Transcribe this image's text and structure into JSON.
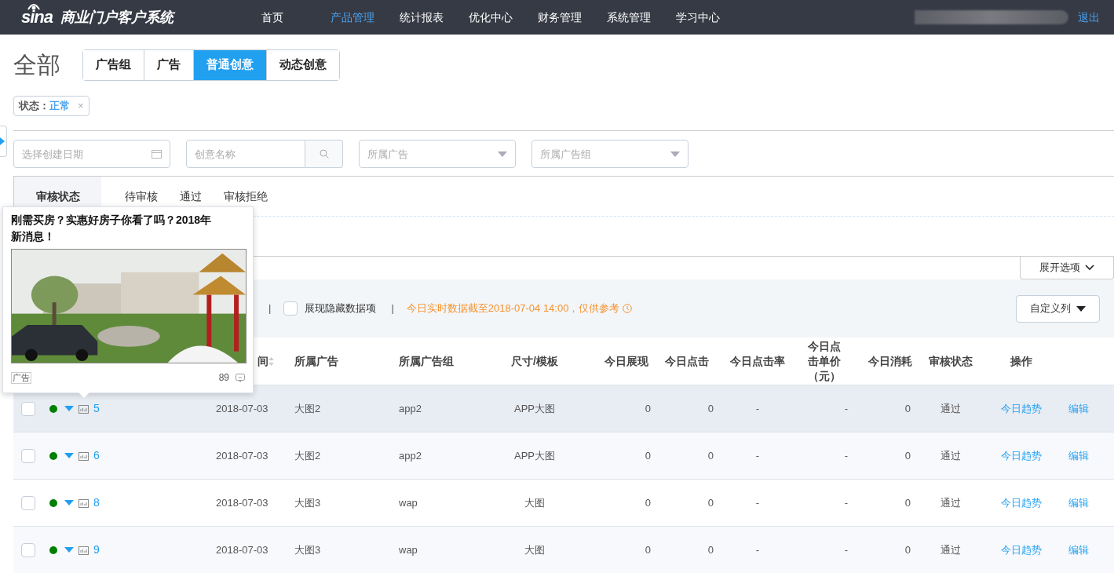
{
  "topbar": {
    "logo": "sina",
    "system_name": "商业门户客户系统",
    "nav": [
      {
        "label": "首页",
        "selected": false
      },
      {
        "label": "产品管理",
        "selected": true
      },
      {
        "label": "统计报表",
        "selected": false
      },
      {
        "label": "优化中心",
        "selected": false
      },
      {
        "label": "财务管理",
        "selected": false
      },
      {
        "label": "系统管理",
        "selected": false
      },
      {
        "label": "学习中心",
        "selected": false
      }
    ],
    "logout": "退出"
  },
  "page_title": "全部",
  "level_tabs": [
    {
      "label": "广告组",
      "selected": false
    },
    {
      "label": "广告",
      "selected": false
    },
    {
      "label": "普通创意",
      "selected": true
    },
    {
      "label": "动态创意",
      "selected": false
    }
  ],
  "filter_tag": {
    "label": "状态：",
    "value": "正常",
    "close": "×"
  },
  "filters": {
    "date": {
      "placeholder": "选择创建日期"
    },
    "name": {
      "placeholder": "创意名称"
    },
    "ad": {
      "placeholder": "所属广告"
    },
    "ad_group": {
      "placeholder": "所属广告组"
    }
  },
  "review_filter": {
    "label": "审核状态",
    "options": [
      {
        "label": "待审核",
        "selected": false
      },
      {
        "label": "通过",
        "selected": false
      },
      {
        "label": "审核拒绝",
        "selected": false
      }
    ]
  },
  "expand_button": "展开选项",
  "toolbar": {
    "separator": "|",
    "show_hidden": {
      "label": "展现隐藏数据项",
      "checked": false
    },
    "notice": "今日实时数据截至2018-07-04 14:00，仅供参考",
    "custom_columns": "自定义列"
  },
  "table": {
    "columns": [
      "间",
      "所属广告",
      "所属广告组",
      "尺寸/模板",
      "今日展现",
      "今日点击",
      "今日点击率",
      "今日点击单价（元）",
      "今日消耗",
      "审核状态",
      "操作"
    ],
    "rows": [
      {
        "hovered": true,
        "checked": false,
        "color": "#008000",
        "id": "5",
        "date": "2018-07-03",
        "ad": "大图2",
        "ad_group": "app2",
        "size": "APP大图",
        "impressions": "0",
        "clicks": "0",
        "ctr": "-",
        "cpc": "-",
        "cost": "0",
        "review": "通过",
        "actions": [
          "今日趋势",
          "编辑"
        ]
      },
      {
        "hovered": false,
        "checked": false,
        "color": "#008000",
        "id": "6",
        "date": "2018-07-03",
        "ad": "大图2",
        "ad_group": "app2",
        "size": "APP大图",
        "impressions": "0",
        "clicks": "0",
        "ctr": "-",
        "cpc": "-",
        "cost": "0",
        "review": "通过",
        "actions": [
          "今日趋势",
          "编辑"
        ]
      },
      {
        "hovered": false,
        "checked": false,
        "color": "#008000",
        "id": "8",
        "date": "2018-07-03",
        "ad": "大图3",
        "ad_group": "wap",
        "size": "大图",
        "impressions": "0",
        "clicks": "0",
        "ctr": "-",
        "cpc": "-",
        "cost": "0",
        "review": "通过",
        "actions": [
          "今日趋势",
          "编辑"
        ]
      },
      {
        "hovered": false,
        "checked": false,
        "color": "#008000",
        "id": "9",
        "date": "2018-07-03",
        "ad": "大图3",
        "ad_group": "wap",
        "size": "大图",
        "impressions": "0",
        "clicks": "0",
        "ctr": "-",
        "cpc": "-",
        "cost": "0",
        "review": "通过",
        "actions": [
          "今日趋势",
          "编辑"
        ]
      }
    ]
  },
  "preview_popup": {
    "title": "刚需买房？实惠好房子你看了吗？2018年新消息！",
    "tag": "广告",
    "count": "89"
  }
}
